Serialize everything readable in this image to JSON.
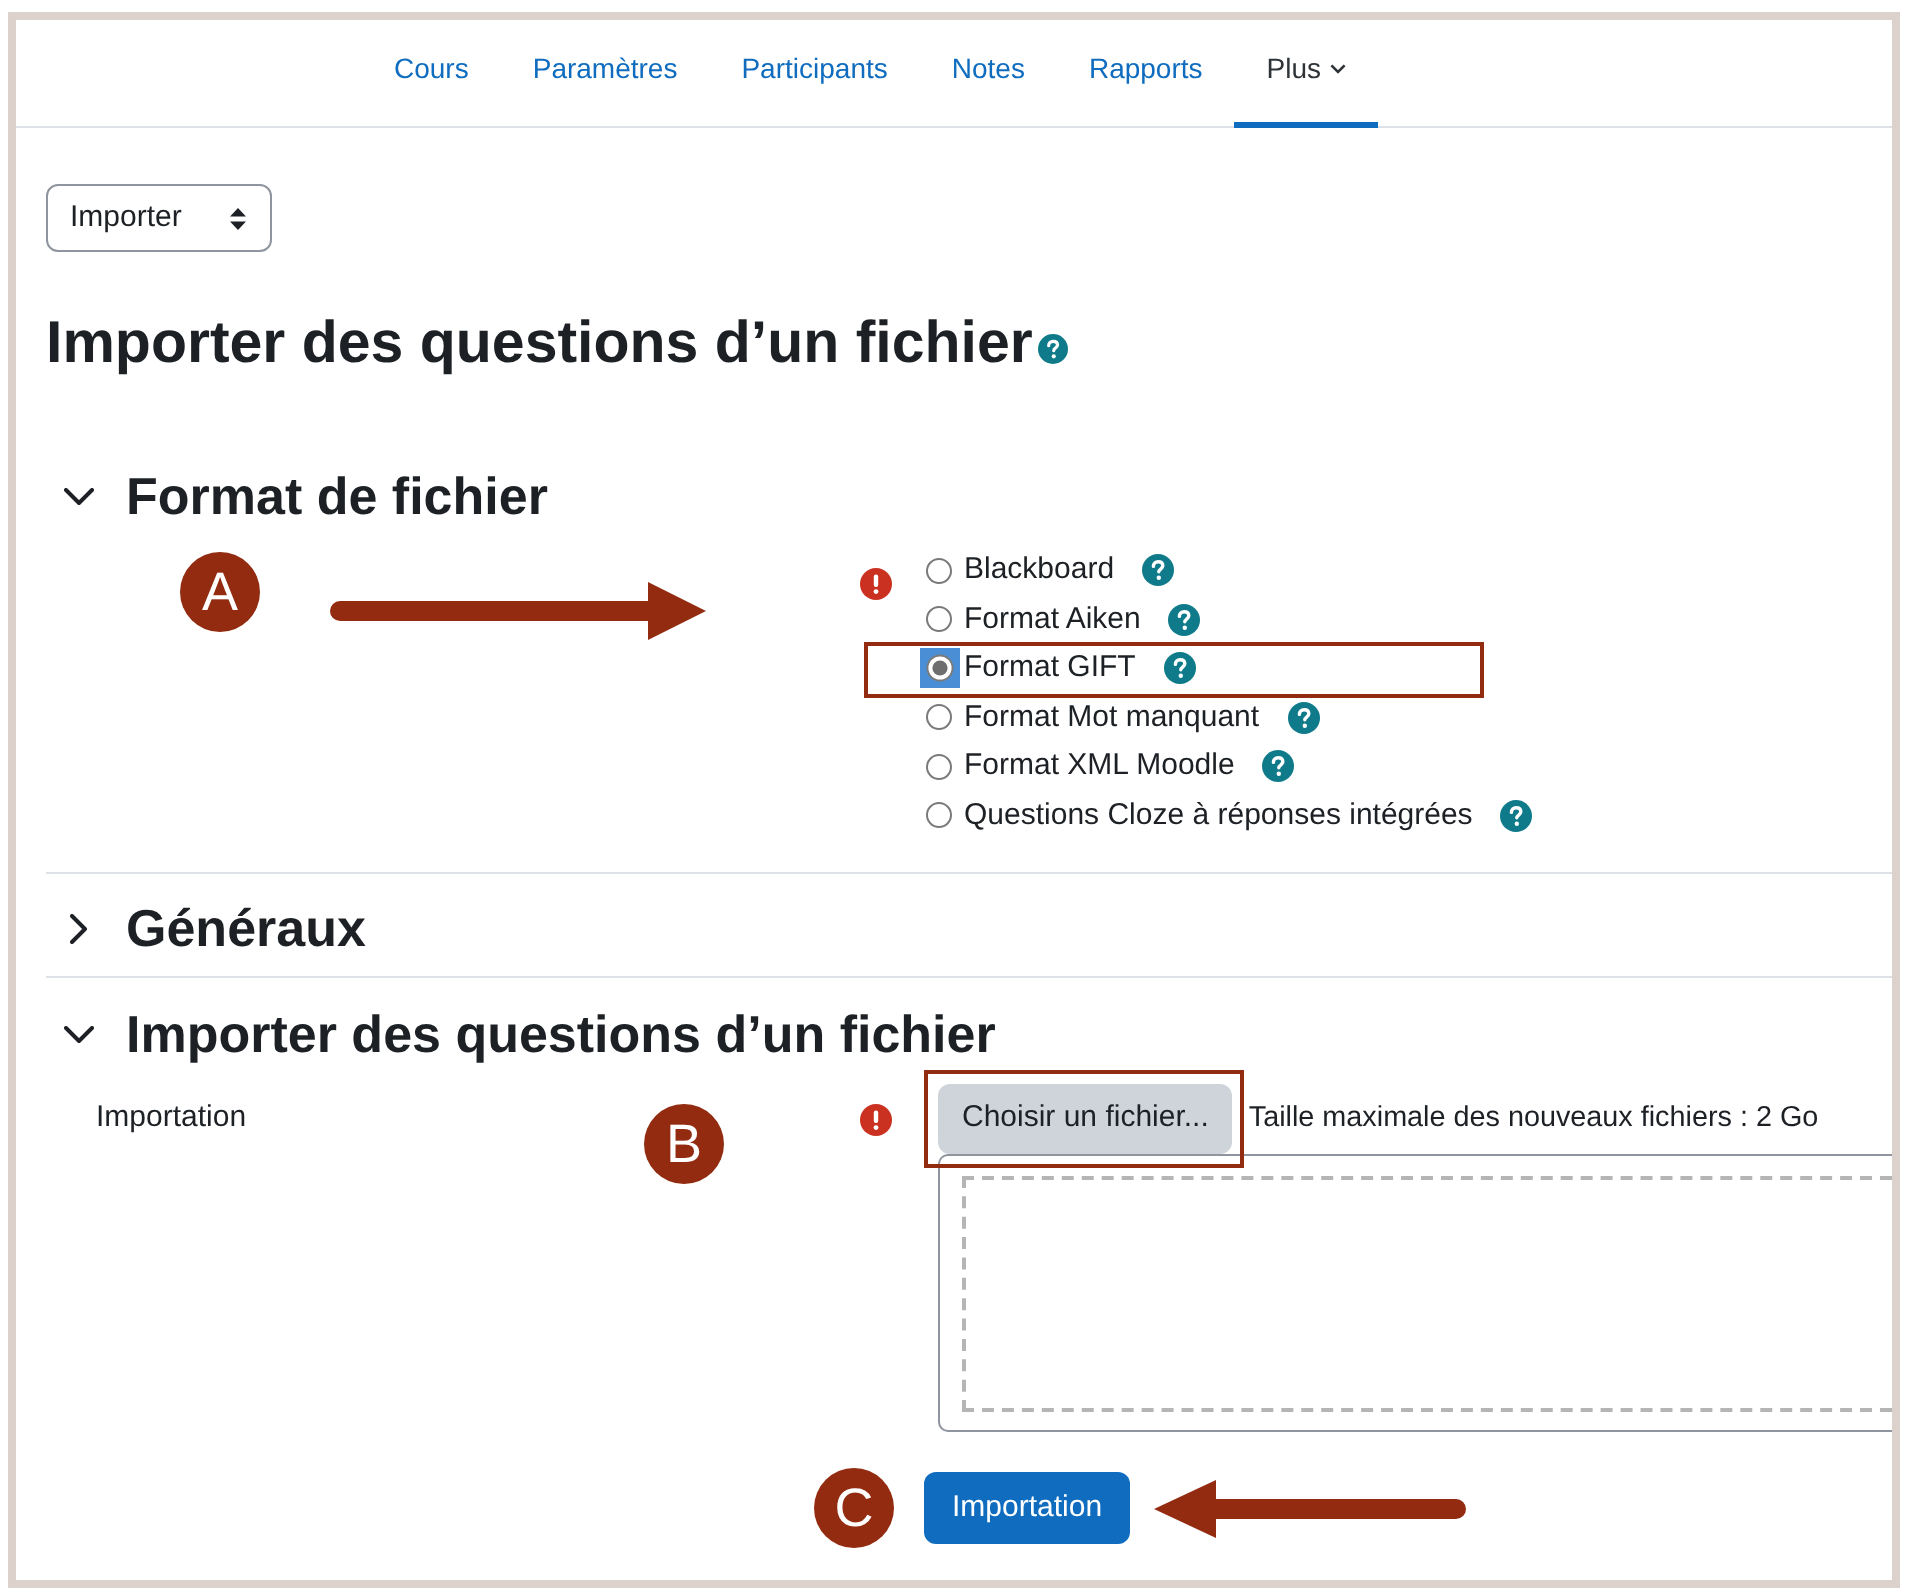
{
  "nav": {
    "tabs": [
      {
        "label": "Cours",
        "selected": false,
        "kind": "link"
      },
      {
        "label": "Paramètres",
        "selected": false,
        "kind": "link"
      },
      {
        "label": "Participants",
        "selected": false,
        "kind": "link"
      },
      {
        "label": "Notes",
        "selected": false,
        "kind": "link"
      },
      {
        "label": "Rapports",
        "selected": false,
        "kind": "link"
      },
      {
        "label": "Plus",
        "selected": true,
        "kind": "menu"
      }
    ]
  },
  "action_select": {
    "value": "Importer"
  },
  "page_title": "Importer des questions d’un fichier",
  "sections": [
    {
      "kind": "radio_group",
      "title": "Format de fichier",
      "expanded": true,
      "required": true,
      "annotation": {
        "label": "A",
        "kind": "right_arrow"
      },
      "options": [
        {
          "label": "Blackboard",
          "selected": false,
          "highlighted": false
        },
        {
          "label": "Format Aiken",
          "selected": false,
          "highlighted": false
        },
        {
          "label": "Format GIFT",
          "selected": true,
          "highlighted": true
        },
        {
          "label": "Format Mot manquant",
          "selected": false,
          "highlighted": false
        },
        {
          "label": "Format XML Moodle",
          "selected": false,
          "highlighted": false
        },
        {
          "label": "Questions Cloze à réponses intégrées",
          "selected": false,
          "highlighted": false
        }
      ]
    },
    {
      "kind": "group",
      "title": "Généraux",
      "expanded": false
    },
    {
      "kind": "file_picker",
      "title": "Importer des questions d’un fichier",
      "expanded": true,
      "required": true,
      "field_label": "Importation",
      "annotation": {
        "label": "B",
        "kind": "marker"
      },
      "button": {
        "label": "Choisir un fichier...",
        "highlighted": true
      },
      "max_size": "Taille maximale des nouveaux fichiers : 2 Go"
    }
  ],
  "submit": {
    "label": "Importation",
    "annotation": {
      "label": "C",
      "kind": "left_arrow"
    }
  }
}
